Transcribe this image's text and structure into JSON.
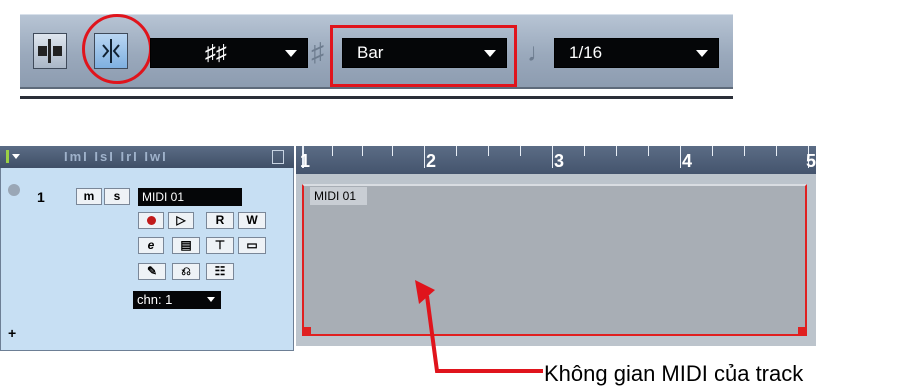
{
  "toolbar": {
    "grid_value": "♯♯",
    "quantize_value": "Bar",
    "length_value": "1/16",
    "grid_symbol": "♯",
    "note_symbol": "♩"
  },
  "track": {
    "number": "1",
    "mute": "m",
    "solo": "s",
    "name": "MIDI 01",
    "read": "R",
    "write": "W",
    "edit": "e",
    "channel": "chn: 1"
  },
  "header": {
    "label": "ImI IsI IrI IwI"
  },
  "ruler": {
    "bars": [
      "1",
      "2",
      "3",
      "4",
      "5"
    ]
  },
  "event": {
    "label": "MIDI 01"
  },
  "annotation": {
    "caption": "Không gian MIDI của track"
  },
  "colors": {
    "highlight": "#e0141c",
    "inspector_bg": "#c7dff3"
  }
}
